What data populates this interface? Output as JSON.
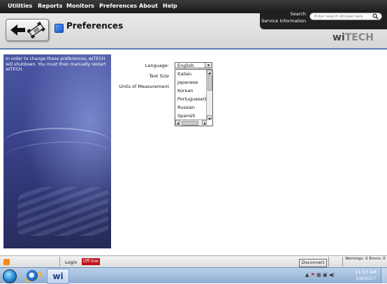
{
  "menu": {
    "items": [
      {
        "label": "Utilities"
      },
      {
        "label": "Reports"
      },
      {
        "label": "Monitors"
      },
      {
        "label": "Preferences"
      },
      {
        "label": "About"
      },
      {
        "label": "Help"
      }
    ]
  },
  "search": {
    "label_line1": "Search",
    "label_line2": "Service Information",
    "placeholder": "Enter search phrase here"
  },
  "header": {
    "title": "Preferences",
    "logo_prefix": "wi",
    "logo_suffix": "TECH"
  },
  "side_panel": {
    "message": "In order to change these preferences, wiTECH will shutdown. You must then manually restart wiTECH."
  },
  "form": {
    "language_label": "Language:",
    "language_selected": "English",
    "text_size_label": "Text Size",
    "units_label": "Units of Measurement",
    "language_options": [
      "Italian",
      "Japanese",
      "Korean",
      "Portuguese(Br",
      "Russian",
      "Spanish"
    ]
  },
  "statusbar": {
    "login": "Login",
    "offline": "Off-line",
    "disconnect": "Disconnect",
    "warnings": "Warnings: 0 Errors: 0"
  },
  "taskbar": {
    "app_label": "wi",
    "time": "11:53 AM",
    "date": "1/6/2017"
  }
}
